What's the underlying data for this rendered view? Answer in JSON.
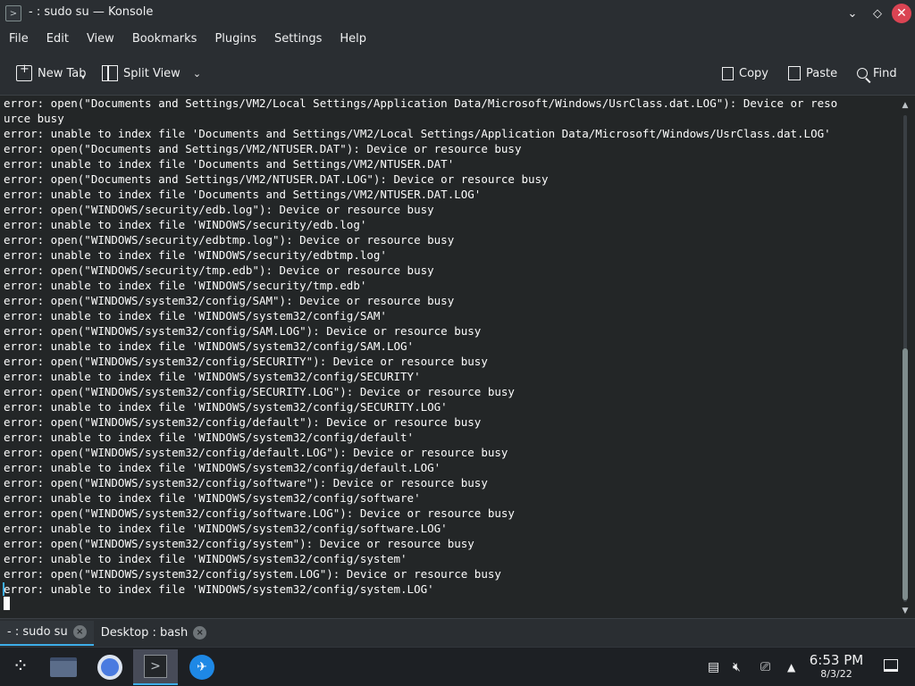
{
  "window": {
    "title": "- : sudo su — Konsole",
    "app_icon": "konsole-icon",
    "controls": [
      "minimize-chevron-icon",
      "float-diamond-icon",
      "close-icon"
    ]
  },
  "menubar": {
    "items": [
      "File",
      "Edit",
      "View",
      "Bookmarks",
      "Plugins",
      "Settings",
      "Help"
    ]
  },
  "toolbar": {
    "new_tab": "New Tab",
    "split_view": "Split View",
    "copy": "Copy",
    "paste": "Paste",
    "find": "Find"
  },
  "terminal": {
    "lines": [
      "error: open(\"Documents and Settings/VM2/Local Settings/Application Data/Microsoft/Windows/UsrClass.dat.LOG\"): Device or reso",
      "urce busy",
      "error: unable to index file 'Documents and Settings/VM2/Local Settings/Application Data/Microsoft/Windows/UsrClass.dat.LOG'",
      "error: open(\"Documents and Settings/VM2/NTUSER.DAT\"): Device or resource busy",
      "error: unable to index file 'Documents and Settings/VM2/NTUSER.DAT'",
      "error: open(\"Documents and Settings/VM2/NTUSER.DAT.LOG\"): Device or resource busy",
      "error: unable to index file 'Documents and Settings/VM2/NTUSER.DAT.LOG'",
      "error: open(\"WINDOWS/security/edb.log\"): Device or resource busy",
      "error: unable to index file 'WINDOWS/security/edb.log'",
      "error: open(\"WINDOWS/security/edbtmp.log\"): Device or resource busy",
      "error: unable to index file 'WINDOWS/security/edbtmp.log'",
      "error: open(\"WINDOWS/security/tmp.edb\"): Device or resource busy",
      "error: unable to index file 'WINDOWS/security/tmp.edb'",
      "error: open(\"WINDOWS/system32/config/SAM\"): Device or resource busy",
      "error: unable to index file 'WINDOWS/system32/config/SAM'",
      "error: open(\"WINDOWS/system32/config/SAM.LOG\"): Device or resource busy",
      "error: unable to index file 'WINDOWS/system32/config/SAM.LOG'",
      "error: open(\"WINDOWS/system32/config/SECURITY\"): Device or resource busy",
      "error: unable to index file 'WINDOWS/system32/config/SECURITY'",
      "error: open(\"WINDOWS/system32/config/SECURITY.LOG\"): Device or resource busy",
      "error: unable to index file 'WINDOWS/system32/config/SECURITY.LOG'",
      "error: open(\"WINDOWS/system32/config/default\"): Device or resource busy",
      "error: unable to index file 'WINDOWS/system32/config/default'",
      "error: open(\"WINDOWS/system32/config/default.LOG\"): Device or resource busy",
      "error: unable to index file 'WINDOWS/system32/config/default.LOG'",
      "error: open(\"WINDOWS/system32/config/software\"): Device or resource busy",
      "error: unable to index file 'WINDOWS/system32/config/software'",
      "error: open(\"WINDOWS/system32/config/software.LOG\"): Device or resource busy",
      "error: unable to index file 'WINDOWS/system32/config/software.LOG'",
      "error: open(\"WINDOWS/system32/config/system\"): Device or resource busy",
      "error: unable to index file 'WINDOWS/system32/config/system'",
      "error: open(\"WINDOWS/system32/config/system.LOG\"): Device or resource busy",
      "error: unable to index file 'WINDOWS/system32/config/system.LOG'"
    ]
  },
  "tabs": [
    {
      "label": "- : sudo su",
      "active": true
    },
    {
      "label": "Desktop : bash",
      "active": false
    }
  ],
  "taskbar": {
    "apps": [
      "folder-icon",
      "chromium-icon",
      "konsole-icon",
      "browser-globe-icon"
    ],
    "active_app": "konsole-icon",
    "tray_icons": [
      "clipboard-icon",
      "volume-muted-icon",
      "network-icon",
      "expand-tray-icon"
    ],
    "time": "6:53 PM",
    "date": "8/3/22"
  },
  "colors": {
    "accent": "#3daee9",
    "close": "#da4453",
    "terminal_bg": "#232627"
  }
}
